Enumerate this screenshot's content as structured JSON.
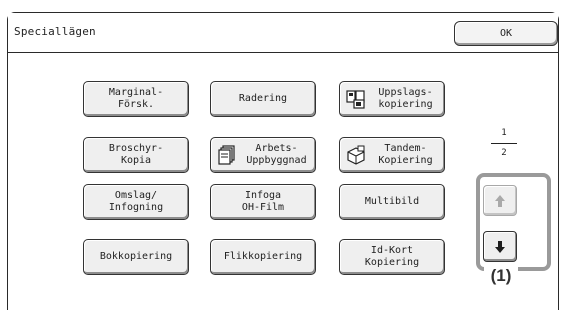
{
  "window": {
    "title": "Speciallägen",
    "ok_label": "OK"
  },
  "buttons": [
    {
      "name": "marginal-forsk-button",
      "label": "Marginal-\nFörsk.",
      "icon": null
    },
    {
      "name": "radering-button",
      "label": "Radering",
      "icon": null
    },
    {
      "name": "uppslags-kopiering-button",
      "label": "Uppslags-\nkopiering",
      "icon": "book-copy-icon"
    },
    {
      "name": "broschyr-kopia-button",
      "label": "Broschyr-\nKopia",
      "icon": null
    },
    {
      "name": "arbets-uppbyggnad-button",
      "label": "Arbets-\nUppbyggnad",
      "icon": "job-build-icon"
    },
    {
      "name": "tandem-kopiering-button",
      "label": "Tandem-\nKopiering",
      "icon": "tandem-copy-icon"
    },
    {
      "name": "omslag-infogning-button",
      "label": "Omslag/\nInfogning",
      "icon": null
    },
    {
      "name": "infoga-oh-film-button",
      "label": "Infoga\nOH-Film",
      "icon": null
    },
    {
      "name": "multibild-button",
      "label": "Multibild",
      "icon": null
    },
    {
      "name": "bokkopiering-button",
      "label": "Bokkopiering",
      "icon": null
    },
    {
      "name": "flikkopiering-button",
      "label": "Flikkopiering",
      "icon": null
    },
    {
      "name": "id-kort-kopiering-button",
      "label": "Id-Kort\nKopiering",
      "icon": null
    }
  ],
  "pager": {
    "current": "1",
    "total": "2",
    "up_icon": "arrow-up-icon",
    "down_icon": "arrow-down-icon",
    "up_enabled": false,
    "down_enabled": true
  },
  "callout": {
    "label": "(1)"
  },
  "colors": {
    "frame": "#9a9a9a",
    "border": "#333333",
    "button_bg": "#efefef"
  }
}
